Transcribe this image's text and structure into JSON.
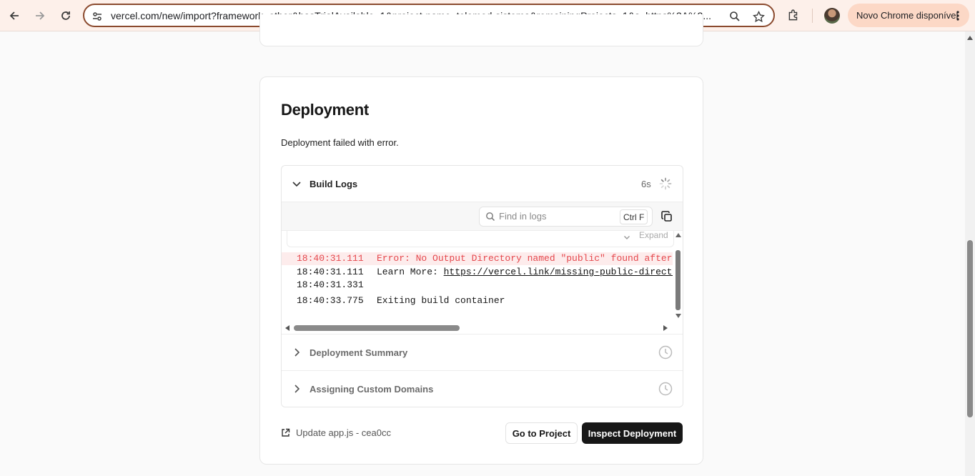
{
  "browser": {
    "url": "vercel.com/new/import?framework=other&hasTrialAvailable=1&project-name=telemed-sistema&remainingProjects=1&s=https%3A%2...",
    "update_chip": "Novo Chrome disponível"
  },
  "deployment": {
    "title": "Deployment",
    "status_text": "Deployment failed with error.",
    "build_logs": {
      "label": "Build Logs",
      "duration": "6s",
      "search_placeholder": "Find in logs",
      "search_shortcut": "Ctrl F",
      "expand_label": "Expand",
      "lines": [
        {
          "time": "18:40:31.111",
          "message": "Error: No Output Directory named \"public\" found after t",
          "level": "error"
        },
        {
          "time": "18:40:31.111",
          "message": "Learn More: ",
          "link": "https://vercel.link/missing-public-director",
          "level": "info"
        },
        {
          "time": "18:40:31.331",
          "message": "",
          "level": "info"
        },
        {
          "time": "18:40:33.775",
          "message": "Exiting build container",
          "level": "info"
        }
      ]
    },
    "sections": [
      {
        "label": "Deployment Summary"
      },
      {
        "label": "Assigning Custom Domains"
      }
    ],
    "commit_link": "Update app.js - cea0cc",
    "go_to_project": "Go to Project",
    "inspect_deployment": "Inspect Deployment"
  },
  "colors": {
    "error_text": "#e5484d",
    "error_bg": "#fdecec",
    "primary_button": "#171717",
    "chrome_bg": "#fdf0ea",
    "chip_bg": "#fcd8c6"
  }
}
